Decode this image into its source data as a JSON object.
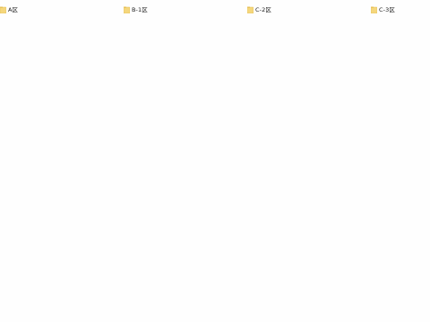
{
  "folders": [
    {
      "label": "A区",
      "icon": "folder-icon"
    },
    {
      "label": "B-1区",
      "icon": "folder-icon"
    },
    {
      "label": "C-2区",
      "icon": "folder-icon"
    },
    {
      "label": "C-3区",
      "icon": "folder-icon"
    }
  ],
  "colors": {
    "folder_fill": "#f5d77c",
    "folder_tab": "#e8c25a",
    "background": "#fefefe",
    "text": "#1a1a1a"
  }
}
